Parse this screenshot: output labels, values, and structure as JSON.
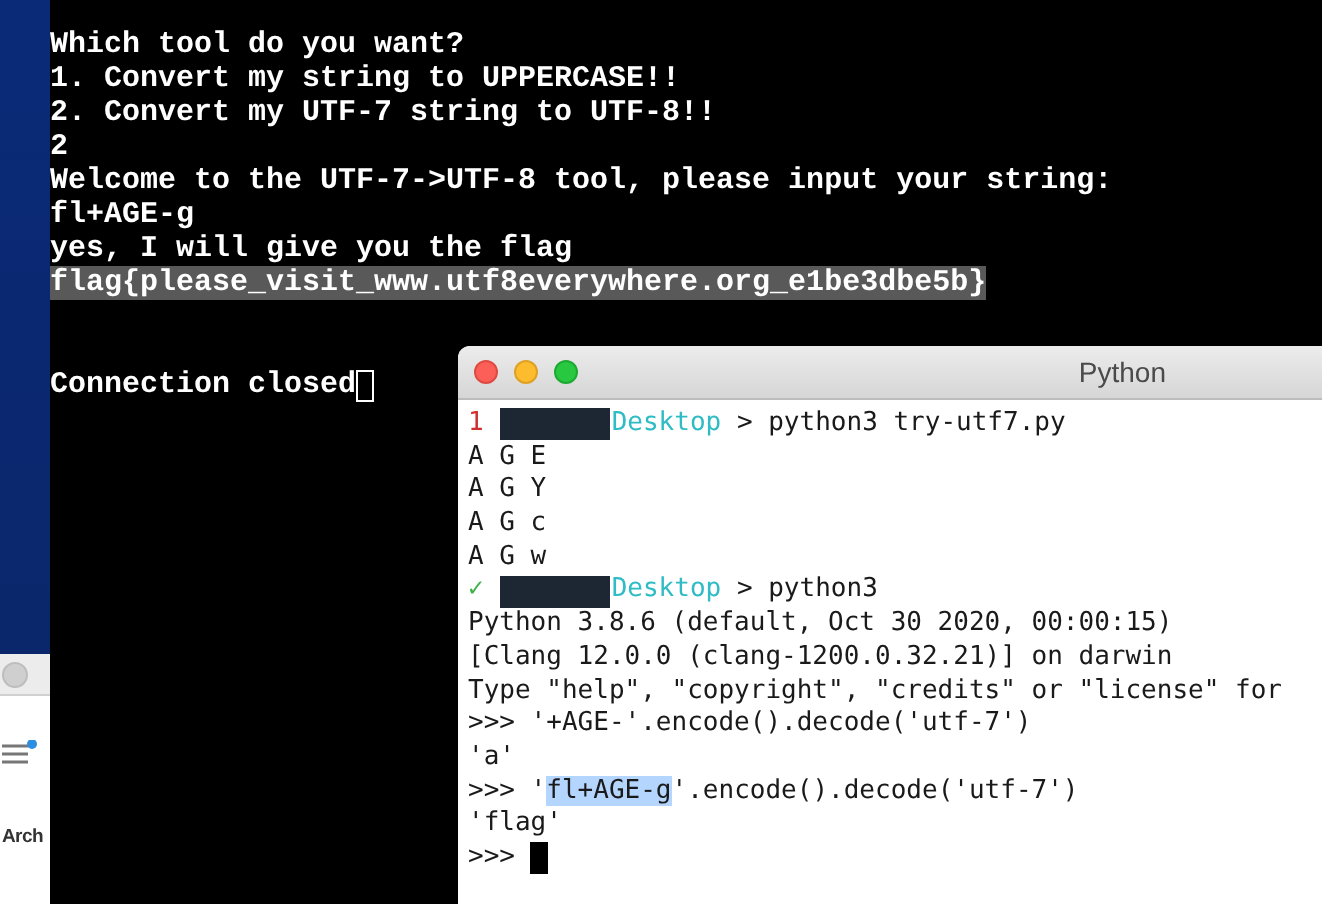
{
  "back_window": {
    "label": "Arch"
  },
  "terminal": {
    "lines": [
      {
        "kind": "text",
        "text": "Which tool do you want?",
        "selected": false
      },
      {
        "kind": "text",
        "text": "1. Convert my string to UPPERCASE!!",
        "selected": false
      },
      {
        "kind": "text",
        "text": "2. Convert my UTF-7 string to UTF-8!!",
        "selected": false
      },
      {
        "kind": "text",
        "text": "2",
        "selected": false
      },
      {
        "kind": "text",
        "text": "Welcome to the UTF-7->UTF-8 tool, please input your string:",
        "selected": false
      },
      {
        "kind": "text",
        "text": "fl+AGE-g",
        "selected": false
      },
      {
        "kind": "text",
        "text": "yes, I will give you the flag",
        "selected": false
      },
      {
        "kind": "text",
        "text": "flag{please_visit_www.utf8everywhere.org_e1be3dbe5b}",
        "selected": true
      },
      {
        "kind": "blank"
      },
      {
        "kind": "blank"
      },
      {
        "kind": "cursor",
        "text": "Connection closed"
      }
    ]
  },
  "python_window": {
    "title": "Python",
    "lines": [
      {
        "kind": "prompt",
        "status": "1",
        "color": "#d0302f",
        "dir": "Desktop",
        "command": " > python3 try-utf7.py"
      },
      {
        "kind": "code",
        "segments": [
          {
            "text": "A G E",
            "selected": false
          }
        ]
      },
      {
        "kind": "code",
        "segments": [
          {
            "text": "A G Y",
            "selected": false
          }
        ]
      },
      {
        "kind": "code",
        "segments": [
          {
            "text": "A G c",
            "selected": false
          }
        ]
      },
      {
        "kind": "code",
        "segments": [
          {
            "text": "A G w",
            "selected": false
          }
        ]
      },
      {
        "kind": "prompt",
        "status": "✓",
        "color": "#3fb24a",
        "dir": "Desktop",
        "command": " > python3"
      },
      {
        "kind": "code",
        "segments": [
          {
            "text": "Python 3.8.6 (default, Oct 30 2020, 00:00:15)",
            "selected": false
          }
        ]
      },
      {
        "kind": "code",
        "segments": [
          {
            "text": "[Clang 12.0.0 (clang-1200.0.32.21)] on darwin",
            "selected": false
          }
        ]
      },
      {
        "kind": "code",
        "segments": [
          {
            "text": "Type \"help\", \"copyright\", \"credits\" or \"license\" for",
            "selected": false
          }
        ]
      },
      {
        "kind": "code",
        "segments": [
          {
            "text": ">>> '+AGE-'.encode().decode('utf-7')",
            "selected": false
          }
        ]
      },
      {
        "kind": "code",
        "segments": [
          {
            "text": "'a'",
            "selected": false
          }
        ]
      },
      {
        "kind": "code",
        "segments": [
          {
            "text": ">>> '",
            "selected": false
          },
          {
            "text": "fl+AGE-g",
            "selected": true
          },
          {
            "text": "'.encode().decode('utf-7')",
            "selected": false
          }
        ]
      },
      {
        "kind": "code",
        "segments": [
          {
            "text": "'flag'",
            "selected": false
          }
        ]
      },
      {
        "kind": "input",
        "text": ">>>"
      }
    ]
  }
}
